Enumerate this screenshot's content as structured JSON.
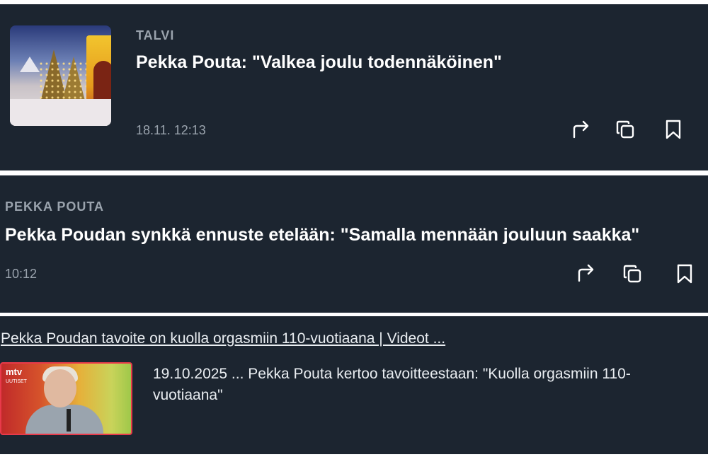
{
  "items": [
    {
      "category": "TALVI",
      "title": "Pekka Pouta: \"Valkea joulu todennäköinen\"",
      "time": "18.11. 12:13"
    },
    {
      "category": "PEKKA POUTA",
      "title": "Pekka Poudan synkkä ennuste etelään: \"Samalla mennään jouluun saakka\"",
      "time": "10:12"
    }
  ],
  "result": {
    "link": "Pekka Poudan tavoite on kuolla orgasmiin 110-vuotiaana | Videot ...",
    "snippet": "19.10.2025 ... Pekka Pouta kertoo tavoitteestaan: \"Kuolla orgasmiin 110-vuotiaana\"",
    "thumb_logo": "mtv",
    "thumb_logo_sub": "UUTISET"
  },
  "icons": [
    "share-icon",
    "copy-icon",
    "bookmark-icon"
  ],
  "colors": {
    "card_bg": "#1c2530",
    "text": "#ffffff",
    "meta": "#9aa3ad",
    "accent": "#e83a4a"
  }
}
